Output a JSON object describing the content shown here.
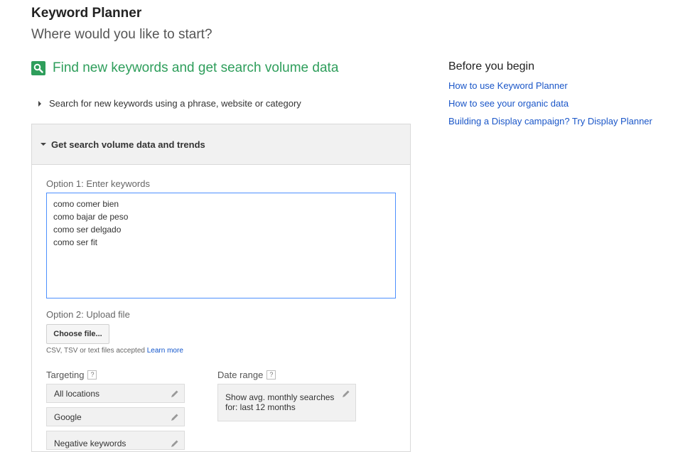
{
  "header": {
    "title": "Keyword Planner",
    "subtitle": "Where would you like to start?"
  },
  "section": {
    "heading": "Find new keywords and get search volume data",
    "icon": "search-icon",
    "accent_color": "#2e9e5b"
  },
  "phrase_search": {
    "label": "Search for new keywords using a phrase, website or category"
  },
  "panel": {
    "header": "Get search volume data and trends",
    "option1_label": "Option 1: Enter keywords",
    "keywords": [
      "como comer bien",
      "como bajar de peso",
      "como ser delgado",
      "como ser fit"
    ],
    "option2_label": "Option 2: Upload file",
    "choose_file_label": "Choose file...",
    "file_note": "CSV, TSV or text files accepted",
    "learn_more": "Learn more",
    "targeting_label": "Targeting",
    "targeting_items": [
      "All locations",
      "Google",
      "Negative keywords"
    ],
    "help_glyph": "?",
    "date_range_label": "Date range",
    "date_range_value": "Show avg. monthly searches for: last 12 months"
  },
  "sidebar": {
    "title": "Before you begin",
    "links": [
      "How to use Keyword Planner",
      "How to see your organic data",
      "Building a Display campaign? Try Display Planner"
    ],
    "link_color": "#1a56c8"
  }
}
